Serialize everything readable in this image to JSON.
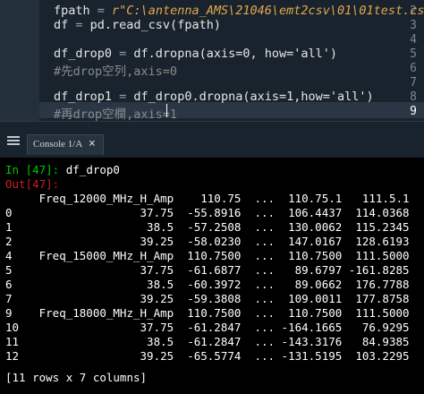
{
  "editor": {
    "line_numbers": [
      "2",
      "3",
      "4",
      "5",
      "6",
      "7",
      "8",
      "9"
    ],
    "current_line": "9",
    "lines": [
      {
        "num": "2",
        "a": "fpath ",
        "b": "= ",
        "c": "r\"C:\\antenna_AMS\\21046\\emt2csv\\01\\01test.csv\""
      },
      {
        "num": "3",
        "a": "df ",
        "b": "= ",
        "c": "pd.read_csv(fpath)"
      },
      {
        "num": "4",
        "a": "",
        "b": "",
        "c": ""
      },
      {
        "num": "5",
        "a": "df_drop0 ",
        "b": "= ",
        "c": "df.dropna(axis=0, how='all')"
      },
      {
        "num": "6",
        "comment": "#先drop空列,axis=0"
      },
      {
        "num": "7",
        "a": "",
        "b": "",
        "c": ""
      },
      {
        "num": "8",
        "a": "df_drop1 ",
        "b": "= ",
        "c": "df_drop0.dropna(axis=1,how='all')"
      },
      {
        "num": "9",
        "comment": "#再drop空欄,axis=1"
      }
    ]
  },
  "console_tab": {
    "label": "Console 1/A",
    "close": "×"
  },
  "console": {
    "in_prompt": "In [47]:",
    "in_code": " df_drop0",
    "out_prompt": "Out[47]:",
    "header": "     Freq_12000_MHz_H_Amp    110.75  ...  110.75.1   111.5.1",
    "rows": [
      "0                   37.75  -55.8916  ...  106.4437  114.0368",
      "1                    38.5  -57.2508  ...  130.0062  115.2345",
      "2                   39.25  -58.0230  ...  147.0167  128.6193",
      "4    Freq_15000_MHz_H_Amp  110.7500  ...  110.7500  111.5000",
      "5                   37.75  -61.6877  ...   89.6797 -161.8285",
      "6                    38.5  -60.3972  ...   89.0662  176.7788",
      "7                   39.25  -59.3808  ...  109.0011  177.8758",
      "9    Freq_18000_MHz_H_Amp  110.7500  ...  110.7500  111.5000",
      "10                  37.75  -61.2847  ... -164.1665   76.9295",
      "11                   38.5  -61.2847  ... -143.3176   84.9385",
      "12                  39.25  -65.5774  ... -131.5195  103.2295"
    ],
    "footer": "[11 rows x 7 columns]"
  }
}
